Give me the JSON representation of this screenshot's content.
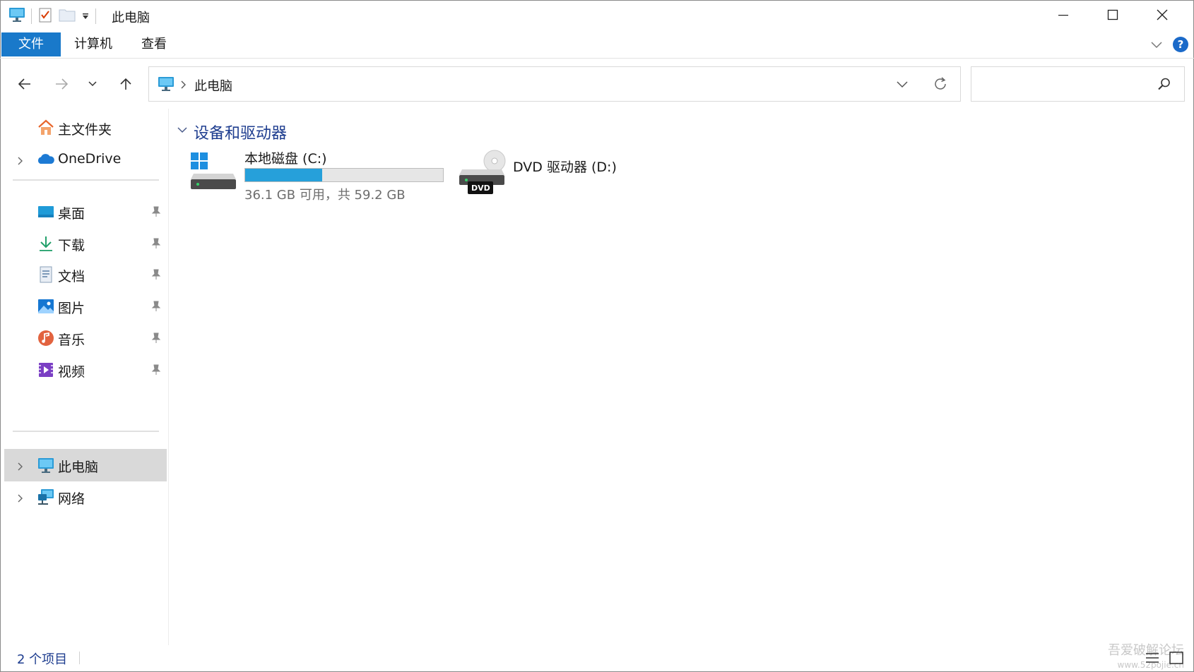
{
  "window": {
    "title": "此电脑",
    "controls": [
      "minimize-icon",
      "maximize-icon",
      "close-icon"
    ]
  },
  "ribbon": {
    "tabs": [
      {
        "label": "文件",
        "active": true
      },
      {
        "label": "计算机",
        "active": false
      },
      {
        "label": "查看",
        "active": false
      }
    ],
    "help_label": "?"
  },
  "address": {
    "crumb": "此电脑",
    "search_placeholder": ""
  },
  "sidebar": {
    "top_items": [
      {
        "label": "主文件夹",
        "icon": "home-icon"
      },
      {
        "label": "OneDrive",
        "icon": "onedrive-cloud-icon"
      }
    ],
    "pinned": [
      {
        "label": "桌面",
        "icon": "desktop-icon"
      },
      {
        "label": "下载",
        "icon": "download-icon"
      },
      {
        "label": "文档",
        "icon": "documents-icon"
      },
      {
        "label": "图片",
        "icon": "pictures-icon"
      },
      {
        "label": "音乐",
        "icon": "music-icon"
      },
      {
        "label": "视频",
        "icon": "videos-icon"
      }
    ],
    "bottom_items": [
      {
        "label": "此电脑",
        "icon": "this-pc-icon",
        "selected": true
      },
      {
        "label": "网络",
        "icon": "network-icon",
        "selected": false
      }
    ]
  },
  "content": {
    "group_title": "设备和驱动器",
    "drives": [
      {
        "name": "本地磁盘 (C:)",
        "free_text": "36.1 GB 可用，共 59.2 GB",
        "used_fraction": 0.39
      },
      {
        "name": "DVD 驱动器 (D:)",
        "badge": "DVD"
      }
    ]
  },
  "status": {
    "item_count": "2 个项目"
  },
  "watermark": {
    "line1": "吾爱破解论坛",
    "line2": "www.52pojie.cn"
  },
  "colors": {
    "accent": "#1979ca",
    "usage_bar": "#26a0da",
    "group_title": "#1e3d8f",
    "selected_bg": "#d9d9d9"
  }
}
